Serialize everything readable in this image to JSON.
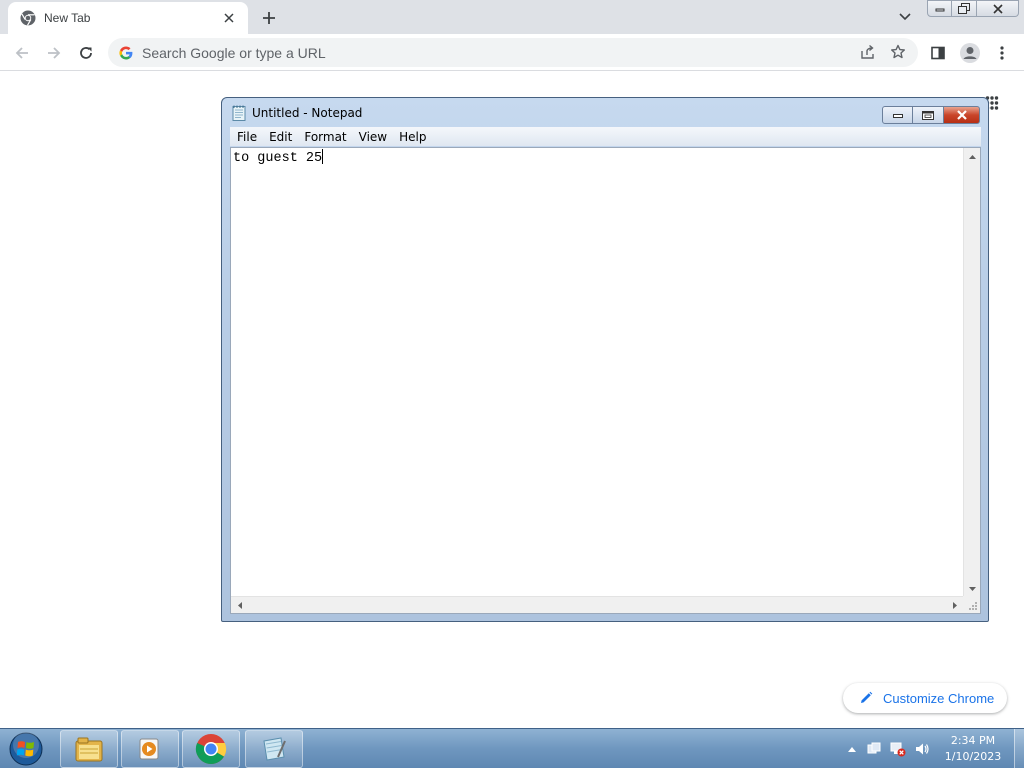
{
  "browser": {
    "tab": {
      "title": "New Tab",
      "favicon": "chrome-icon"
    },
    "omnibox": {
      "placeholder": "Search Google or type a URL",
      "value": ""
    },
    "customize_label": "Customize Chrome"
  },
  "notepad": {
    "title": "Untitled - Notepad",
    "menu": [
      "File",
      "Edit",
      "Format",
      "View",
      "Help"
    ],
    "content": "to guest 25"
  },
  "taskbar": {
    "items": [
      "file-explorer-icon",
      "media-player-icon",
      "chrome-icon",
      "notepad-icon"
    ],
    "clock": {
      "time": "2:34 PM",
      "date": "1/10/2023"
    }
  }
}
